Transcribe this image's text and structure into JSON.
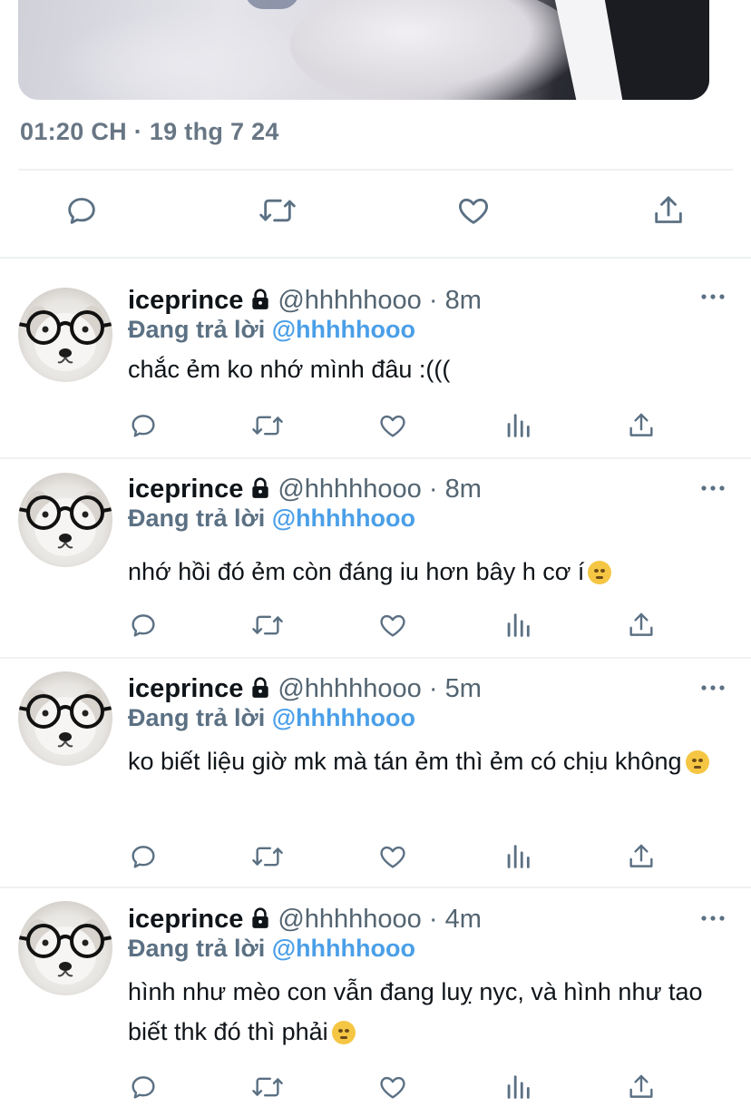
{
  "tweet": {
    "timestamp": "01:20 CH · 19 thg 7 24",
    "actions": [
      "reply-icon",
      "retweet-icon",
      "like-icon",
      "share-icon"
    ]
  },
  "colors": {
    "handle_gray": "#536471",
    "replying_gray": "#5b7083",
    "link_blue": "#4a9fe8",
    "divider": "#eff1f3"
  },
  "replies": [
    {
      "name": "iceprince",
      "handle": "@hhhhhooo",
      "time": " · 8m",
      "replying_prefix": "Đang trả lời ",
      "replying_to": "@hhhhhooo",
      "text": "chắc ẻm ko nhớ mình đâu :((("
    },
    {
      "name": "iceprince",
      "handle": "@hhhhhooo",
      "time": " · 8m",
      "replying_prefix": "Đang trả lời ",
      "replying_to": "@hhhhhooo",
      "text": "nhớ hồi đó ẻm còn đáng iu hơn bây h cơ í",
      "emoji": "pleading-face-emoji"
    },
    {
      "name": "iceprince",
      "handle": "@hhhhhooo",
      "time": " · 5m",
      "replying_prefix": "Đang trả lời ",
      "replying_to": "@hhhhhooo",
      "text": "ko biết liệu giờ mk mà tán ẻm thì ẻm có chịu không",
      "emoji": "pensive-face-emoji"
    },
    {
      "name": "iceprince",
      "handle": "@hhhhhooo",
      "time": " · 4m",
      "replying_prefix": "Đang trả lời ",
      "replying_to": "@hhhhhooo",
      "text": "hình như mèo con vẫn đang luỵ nyc, và hình như tao biết thk đó thì phải",
      "emoji": "upside-down-face-emoji"
    }
  ]
}
